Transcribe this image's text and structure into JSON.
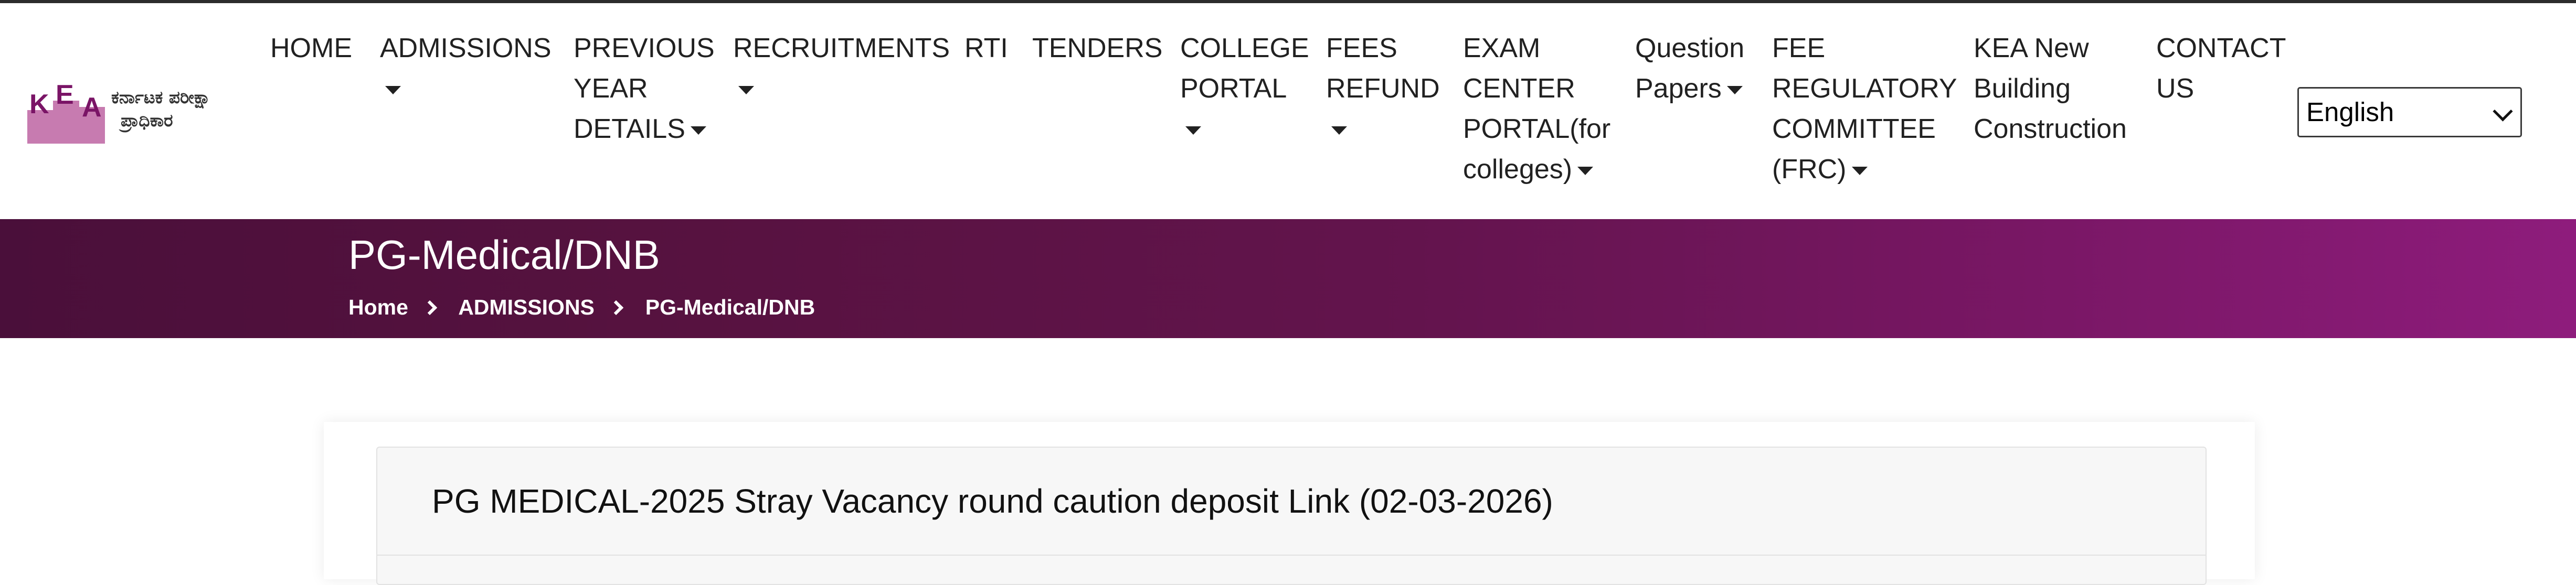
{
  "logo": {
    "letters": [
      "K",
      "E",
      "A"
    ],
    "text_line1": "ಕರ್ನಾಟಕ ಪರೀಕ್ಷಾ",
    "text_line2": "ಪ್ರಾಧಿಕಾರ",
    "brand_color": "#b4408f"
  },
  "nav": {
    "items": [
      {
        "lines": [
          "HOME"
        ],
        "dropdown": false
      },
      {
        "lines": [
          "ADMISSIONS"
        ],
        "dropdown": true
      },
      {
        "lines": [
          "PREVIOUS",
          "YEAR",
          "DETAILS"
        ],
        "dropdown": true
      },
      {
        "lines": [
          "RECRUITMENTS"
        ],
        "dropdown": true
      },
      {
        "lines": [
          "RTI"
        ],
        "dropdown": false
      },
      {
        "lines": [
          "TENDERS"
        ],
        "dropdown": false
      },
      {
        "lines": [
          "COLLEGE",
          "PORTAL"
        ],
        "dropdown": true
      },
      {
        "lines": [
          "FEES",
          "REFUND"
        ],
        "dropdown": true
      },
      {
        "lines": [
          "EXAM",
          "CENTER",
          "PORTAL(for",
          "colleges)"
        ],
        "dropdown": true
      },
      {
        "lines": [
          "Question",
          "Papers"
        ],
        "dropdown": true
      },
      {
        "lines": [
          "FEE",
          "REGULATORY",
          "COMMITTEE",
          "(FRC)"
        ],
        "dropdown": true
      },
      {
        "lines": [
          "KEA New",
          "Building",
          "Construction"
        ],
        "dropdown": false
      },
      {
        "lines": [
          "CONTACT",
          "US"
        ],
        "dropdown": false
      }
    ],
    "language_select": "English"
  },
  "banner": {
    "title": "PG-Medical/DNB",
    "breadcrumb": [
      "Home",
      "ADMISSIONS",
      "PG-Medical/DNB"
    ],
    "gradient_start": "#4a0f3a",
    "gradient_end": "#8e1c7c"
  },
  "content": {
    "panel_title": "PG MEDICAL-2025 Stray Vacancy round caution deposit Link (02-03-2026)"
  }
}
